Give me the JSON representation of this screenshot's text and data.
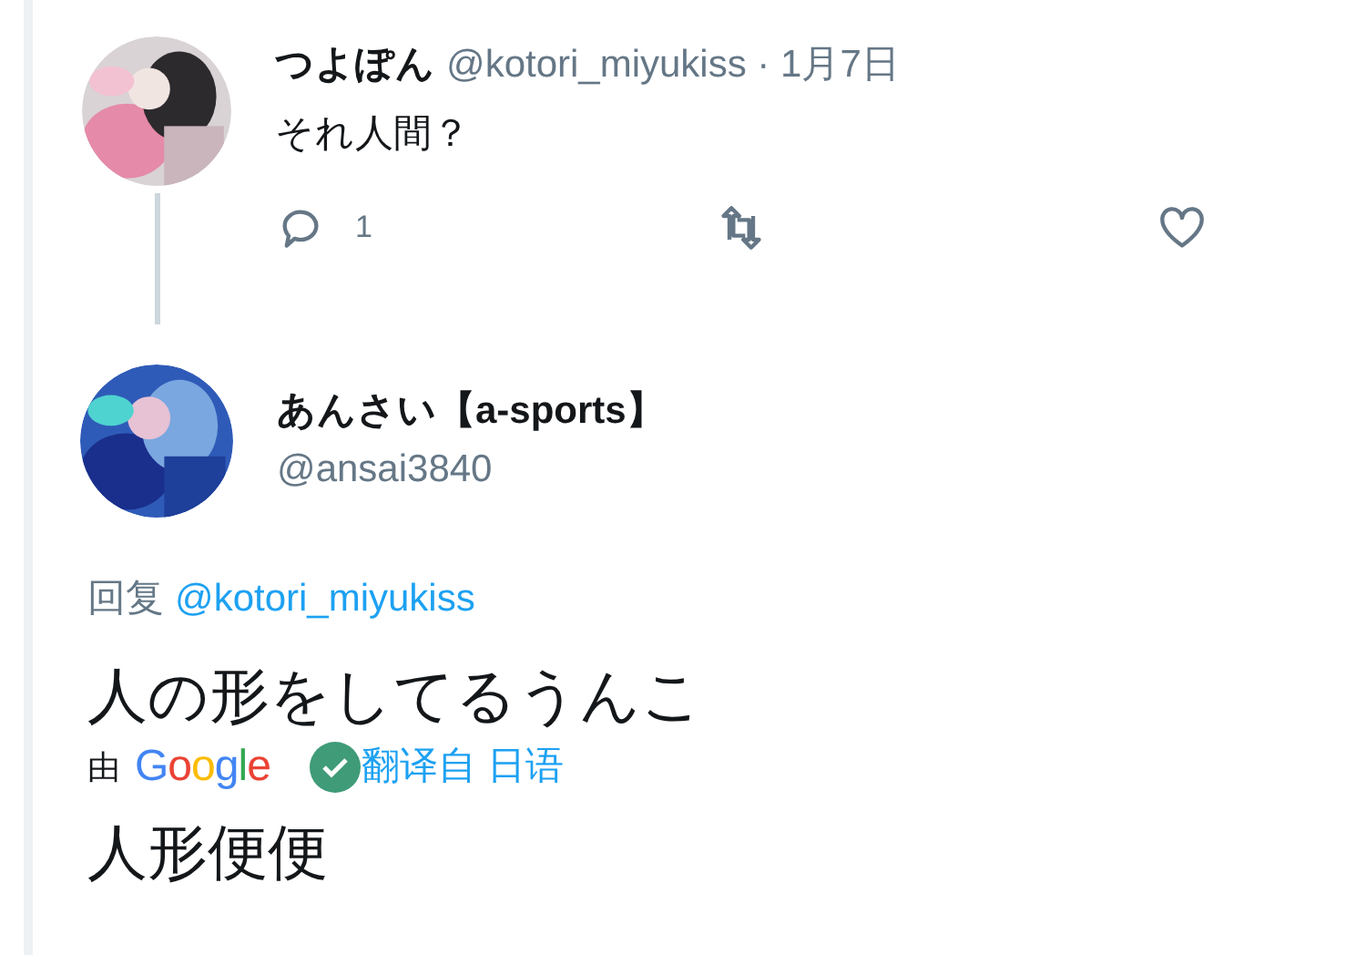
{
  "parent_tweet": {
    "display_name": "つよぽん",
    "handle": "@kotori_miyukiss",
    "separator": "·",
    "date": "1月7日",
    "text": "それ人間？",
    "actions": [
      {
        "kind": "reply",
        "count": "1"
      },
      {
        "kind": "retweet"
      },
      {
        "kind": "like"
      }
    ]
  },
  "tweet": {
    "display_name": "あんさい【a-sports】",
    "handle": "@ansai3840",
    "reply_label": "回复",
    "reply_to": "@kotori_miyukiss",
    "text": "人の形をしてるうんこ",
    "translation": {
      "by": "由",
      "provider": "Google",
      "verified": true,
      "label": "翻译自 日语",
      "text": "人形便便"
    }
  }
}
